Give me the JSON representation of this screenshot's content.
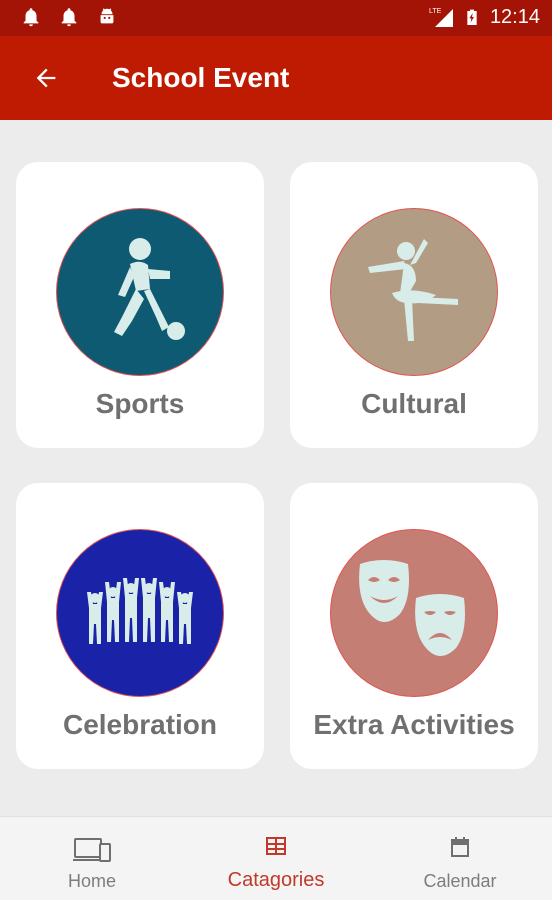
{
  "status_bar": {
    "time": "12:14",
    "network": "LTE",
    "icons": [
      "notification-bell-icon",
      "notification-bell-icon",
      "android-icon",
      "signal-icon",
      "battery-charging-icon"
    ]
  },
  "app_bar": {
    "title": "School Event",
    "back_icon": "arrow-left-icon"
  },
  "categories": [
    {
      "label": "Sports",
      "icon": "soccer-player-icon",
      "circle_color": "#0d5a72"
    },
    {
      "label": "Cultural",
      "icon": "ballet-dancer-icon",
      "circle_color": "#b39c84"
    },
    {
      "label": "Celebration",
      "icon": "cheering-crowd-icon",
      "circle_color": "#1a22a8"
    },
    {
      "label": "Extra Activities",
      "icon": "theater-masks-icon",
      "circle_color": "#c47e73"
    }
  ],
  "bottom_nav": {
    "items": [
      {
        "label": "Home",
        "icon": "devices-icon",
        "active": false
      },
      {
        "label": "Catagories",
        "icon": "grid-icon",
        "active": true
      },
      {
        "label": "Calendar",
        "icon": "calendar-icon",
        "active": false
      }
    ]
  },
  "colors": {
    "status_bar": "#a31407",
    "app_bar": "#bf1a02",
    "active_tab": "#c0392b",
    "card_border_accent": "#e35252",
    "icon_fill": "#d8ecea"
  }
}
